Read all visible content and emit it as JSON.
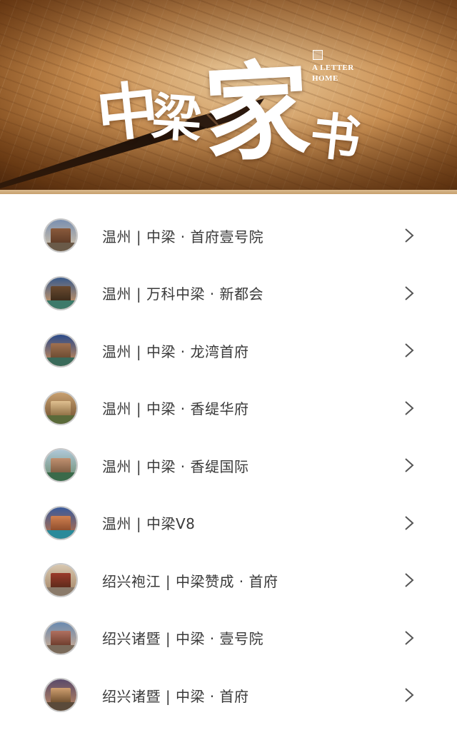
{
  "banner": {
    "title_chars": [
      "中",
      "梁",
      "家",
      "书"
    ],
    "tagline_line1": "A LETTER",
    "tagline_line2": "HOME"
  },
  "items": [
    {
      "label": "温州 | 中梁 · 首府壹号院",
      "icon": "chevron-right"
    },
    {
      "label": "温州 | 万科中梁 · 新都会",
      "icon": "chevron-right"
    },
    {
      "label": "温州 | 中梁 · 龙湾首府",
      "icon": "chevron-right"
    },
    {
      "label": "温州 | 中梁 · 香缇华府",
      "icon": "chevron-right"
    },
    {
      "label": "温州 | 中梁 · 香缇国际",
      "icon": "chevron-right"
    },
    {
      "label": "温州 | 中梁V8",
      "icon": "chevron-right"
    },
    {
      "label": "绍兴袍江 | 中梁赞成 · 首府",
      "icon": "chevron-right"
    },
    {
      "label": "绍兴诸暨 | 中梁 · 壹号院",
      "icon": "chevron-right"
    },
    {
      "label": "绍兴诸暨 | 中梁 · 首府",
      "icon": "chevron-right"
    }
  ],
  "colors": {
    "text": "#3a3a3a",
    "chevron": "#555555",
    "thumb_border": "#c8c8c8"
  }
}
